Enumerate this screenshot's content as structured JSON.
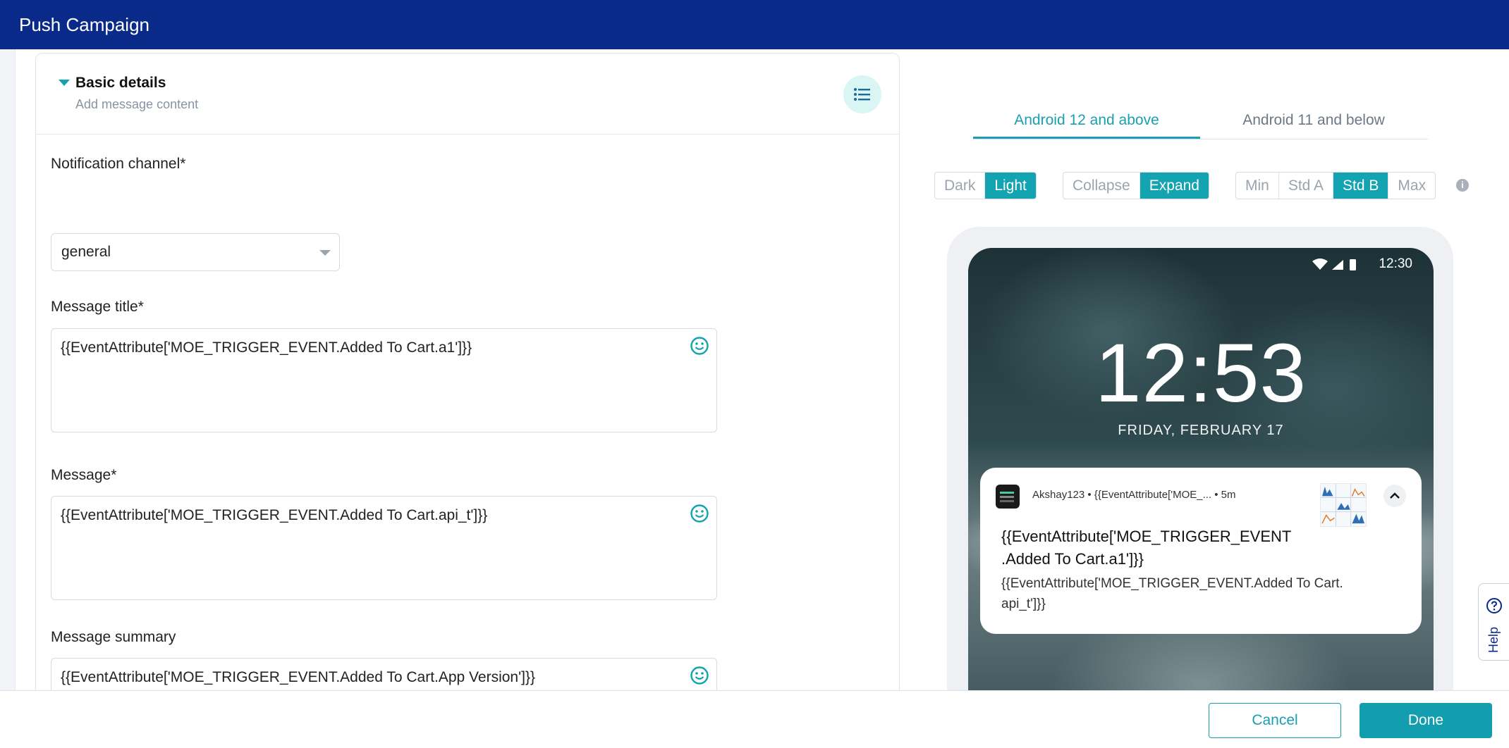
{
  "window": {
    "title": "Push Campaign"
  },
  "section": {
    "title": "Basic details",
    "subtitle": "Add message content"
  },
  "form": {
    "channel": {
      "label": "Notification channel*",
      "value": "general"
    },
    "title": {
      "label": "Message title*",
      "value": "{{EventAttribute['MOE_TRIGGER_EVENT.Added To Cart.a1']}}"
    },
    "message": {
      "label": "Message*",
      "value": "{{EventAttribute['MOE_TRIGGER_EVENT.Added To Cart.api_t']}}"
    },
    "summary": {
      "label": "Message summary",
      "value": "{{EventAttribute['MOE_TRIGGER_EVENT.Added To Cart.App Version']}}"
    }
  },
  "preview": {
    "tabs": [
      {
        "label": "Android 12 and above",
        "active": true
      },
      {
        "label": "Android 11 and below",
        "active": false
      }
    ],
    "theme": {
      "options": [
        "Dark",
        "Light"
      ],
      "selected": "Light"
    },
    "mode": {
      "options": [
        "Collapse",
        "Expand"
      ],
      "selected": "Expand"
    },
    "size": {
      "options": [
        "Min",
        "Std A",
        "Std B",
        "Max"
      ],
      "selected": "Std B"
    },
    "info_icon": "i",
    "phone": {
      "status_time": "12:30",
      "lock_time": "12:53",
      "lock_date": "FRIDAY, FEBRUARY 17",
      "notification": {
        "meta": "Akshay123 • {{EventAttribute['MOE_... • 5m",
        "title_line1": "{{EventAttribute['MOE_TRIGGER_EVENT",
        "title_line2": ".Added To Cart.a1']}}",
        "body_line1": "{{EventAttribute['MOE_TRIGGER_EVENT.Added To Cart.",
        "body_line2": "api_t']}}"
      }
    }
  },
  "help": {
    "label": "Help"
  },
  "footer": {
    "cancel_label": "Cancel",
    "done_label": "Done"
  },
  "colors": {
    "header": "#0a2a8a",
    "accent": "#129eae"
  }
}
